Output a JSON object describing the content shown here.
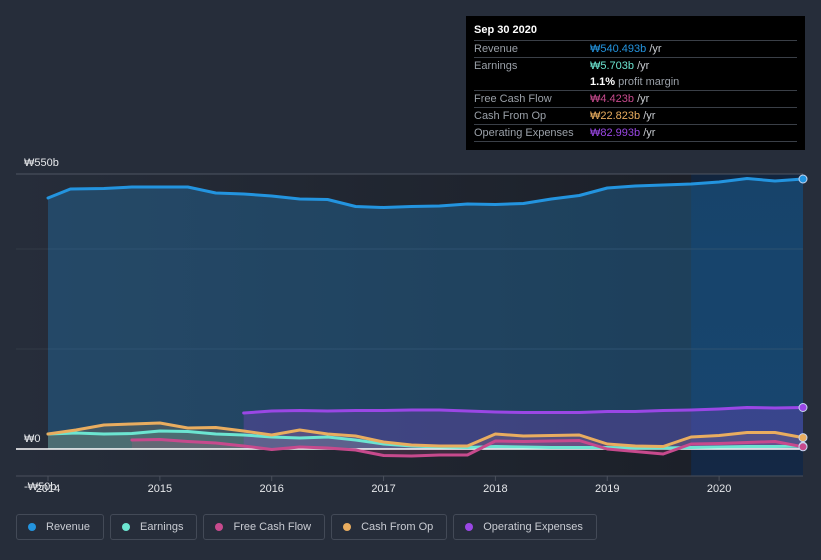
{
  "tooltip": {
    "date": "Sep 30 2020",
    "rows": [
      {
        "label": "Revenue",
        "value": "₩540.493b",
        "unit": " /yr",
        "color": "#2394df"
      },
      {
        "label": "Earnings",
        "value": "₩5.703b",
        "unit": " /yr",
        "color": "#6ce5d1"
      },
      {
        "label": "Free Cash Flow",
        "value": "₩4.423b",
        "unit": " /yr",
        "color": "#c74a8d"
      },
      {
        "label": "Cash From Op",
        "value": "₩22.823b",
        "unit": " /yr",
        "color": "#e9ad5f"
      },
      {
        "label": "Operating Expenses",
        "value": "₩82.993b",
        "unit": " /yr",
        "color": "#9a47e5"
      }
    ],
    "profit_margin_value": "1.1%",
    "profit_margin_label": " profit margin"
  },
  "legend": [
    {
      "label": "Revenue",
      "color": "#2394df"
    },
    {
      "label": "Earnings",
      "color": "#6ce5d1"
    },
    {
      "label": "Free Cash Flow",
      "color": "#c74a8d"
    },
    {
      "label": "Cash From Op",
      "color": "#e9ad5f"
    },
    {
      "label": "Operating Expenses",
      "color": "#9a47e5"
    }
  ],
  "chart_data": {
    "type": "line",
    "title": "",
    "xlabel": "",
    "ylabel": "",
    "y_tick_labels": [
      "₩550b",
      "₩0",
      "-₩50b"
    ],
    "y_ticks": [
      550,
      0,
      -50
    ],
    "ylim": [
      -50,
      550
    ],
    "xlim": [
      2014.0,
      2020.75
    ],
    "x_tick_labels": [
      "2014",
      "2015",
      "2016",
      "2017",
      "2018",
      "2019",
      "2020"
    ],
    "x_ticks": [
      2014,
      2015,
      2016,
      2017,
      2018,
      2019,
      2020
    ],
    "highlight_from": 2019.75,
    "grid": true,
    "series": [
      {
        "name": "Revenue",
        "color": "#2394df",
        "x": [
          2014.0,
          2014.2,
          2014.5,
          2014.75,
          2015.0,
          2015.25,
          2015.5,
          2015.75,
          2016.0,
          2016.25,
          2016.5,
          2016.75,
          2017.0,
          2017.25,
          2017.5,
          2017.75,
          2018.0,
          2018.25,
          2018.5,
          2018.75,
          2019.0,
          2019.25,
          2019.5,
          2019.75,
          2020.0,
          2020.25,
          2020.5,
          2020.75
        ],
        "y": [
          502,
          520,
          521,
          524,
          524,
          524,
          512,
          510,
          506,
          500,
          499,
          485,
          483,
          485,
          486,
          490,
          489,
          491,
          500,
          507,
          522,
          526,
          528,
          530,
          534,
          541,
          536,
          540
        ]
      },
      {
        "name": "Earnings",
        "color": "#6ce5d1",
        "x": [
          2014.0,
          2014.25,
          2014.5,
          2014.75,
          2015.0,
          2015.25,
          2015.5,
          2015.75,
          2016.0,
          2016.25,
          2016.5,
          2016.75,
          2017.0,
          2017.25,
          2017.5,
          2017.75,
          2018.0,
          2018.25,
          2018.5,
          2018.75,
          2019.0,
          2019.25,
          2019.5,
          2019.75,
          2020.0,
          2020.25,
          2020.5,
          2020.75
        ],
        "y": [
          30,
          32,
          30,
          31,
          36,
          35,
          30,
          28,
          24,
          22,
          24,
          18,
          10,
          6,
          4,
          3,
          5,
          4,
          3,
          3,
          3,
          2,
          2,
          3,
          4,
          5,
          5,
          5.7
        ]
      },
      {
        "name": "Free Cash Flow",
        "color": "#c74a8d",
        "x": [
          2014.75,
          2015.0,
          2015.25,
          2015.5,
          2015.75,
          2016.0,
          2016.25,
          2016.5,
          2016.75,
          2017.0,
          2017.25,
          2017.5,
          2017.75,
          2018.0,
          2018.25,
          2018.5,
          2018.75,
          2019.0,
          2019.25,
          2019.5,
          2019.75,
          2020.0,
          2020.25,
          2020.5,
          2020.75
        ],
        "y": [
          18,
          19,
          15,
          12,
          6,
          -1,
          4,
          2,
          -2,
          -13,
          -14,
          -12,
          -12,
          16,
          15,
          16,
          17,
          0,
          -5,
          -10,
          10,
          11,
          13,
          15,
          4.4
        ]
      },
      {
        "name": "Cash From Op",
        "color": "#e9ad5f",
        "x": [
          2014.0,
          2014.25,
          2014.5,
          2014.75,
          2015.0,
          2015.25,
          2015.5,
          2015.75,
          2016.0,
          2016.25,
          2016.5,
          2016.75,
          2017.0,
          2017.25,
          2017.5,
          2017.75,
          2018.0,
          2018.25,
          2018.5,
          2018.75,
          2019.0,
          2019.25,
          2019.5,
          2019.75,
          2020.0,
          2020.25,
          2020.5,
          2020.75
        ],
        "y": [
          30,
          38,
          48,
          50,
          52,
          42,
          43,
          36,
          28,
          38,
          30,
          26,
          14,
          8,
          6,
          6,
          30,
          26,
          27,
          28,
          10,
          6,
          5,
          24,
          27,
          33,
          33,
          22.8
        ]
      },
      {
        "name": "Operating Expenses",
        "color": "#9a47e5",
        "x": [
          2015.75,
          2016.0,
          2016.25,
          2016.5,
          2016.75,
          2017.0,
          2017.25,
          2017.5,
          2017.75,
          2018.0,
          2018.25,
          2018.5,
          2018.75,
          2019.0,
          2019.25,
          2019.5,
          2019.75,
          2020.0,
          2020.25,
          2020.5,
          2020.75
        ],
        "y": [
          72,
          76,
          77,
          76,
          77,
          77,
          78,
          78,
          76,
          74,
          73,
          73,
          73,
          75,
          75,
          77,
          78,
          80,
          83,
          82,
          83
        ]
      }
    ]
  }
}
